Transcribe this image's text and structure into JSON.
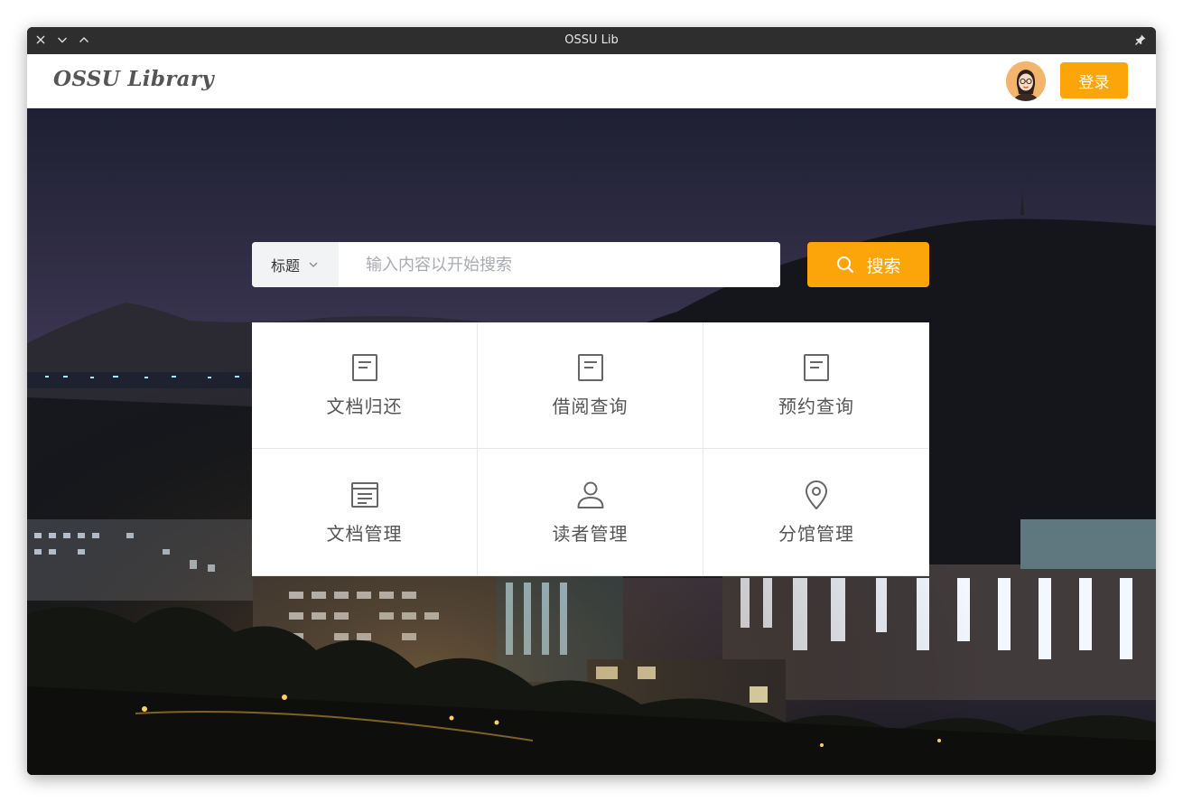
{
  "window": {
    "title": "OSSU Lib"
  },
  "appbar": {
    "logo": "OSSU Library",
    "login_label": "登录"
  },
  "search": {
    "field_selected": "标题",
    "placeholder": "输入内容以开始搜索",
    "value": "",
    "button_label": "搜索"
  },
  "tiles": [
    {
      "label": "文档归还",
      "icon": "document-icon"
    },
    {
      "label": "借阅查询",
      "icon": "document-icon"
    },
    {
      "label": "预约查询",
      "icon": "document-icon"
    },
    {
      "label": "文档管理",
      "icon": "document-list-icon"
    },
    {
      "label": "读者管理",
      "icon": "user-icon"
    },
    {
      "label": "分馆管理",
      "icon": "location-pin-icon"
    }
  ],
  "colors": {
    "accent": "#fca50a",
    "titlebar": "#2e2e2e",
    "tile_text": "#555555"
  }
}
